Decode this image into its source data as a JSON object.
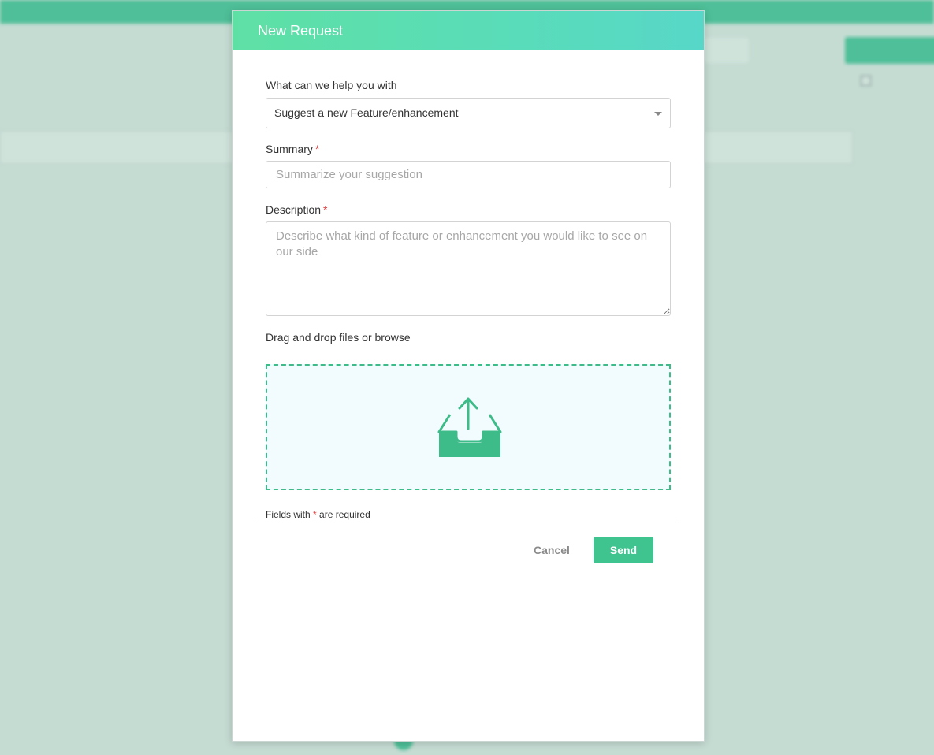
{
  "modal": {
    "title": "New Request",
    "help_label": "What can we help you with",
    "help_selected": "Suggest a new Feature/enhancement",
    "summary_label": "Summary",
    "summary_placeholder": "Summarize your suggestion",
    "description_label": "Description",
    "description_placeholder": "Describe what kind of feature or enhancement you would like to see on our side",
    "attach_label": "Drag and drop files or browse",
    "required_note_prefix": "Fields with",
    "required_note_suffix": "are required",
    "required_marker": "*",
    "cancel_label": "Cancel",
    "send_label": "Send"
  },
  "colors": {
    "header_gradient_start": "#5ee0a5",
    "header_gradient_end": "#57d7c8",
    "accent": "#3fc38f",
    "required": "#e04444"
  },
  "icons": {
    "upload": "inbox-upload-icon",
    "caret": "chevron-down-icon"
  }
}
